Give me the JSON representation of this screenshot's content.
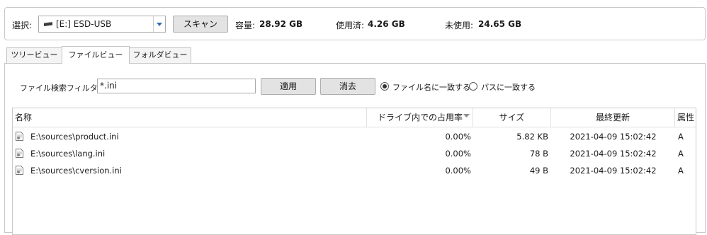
{
  "toolbar": {
    "select_label": "選択:",
    "drive_value": "[E:] ESD-USB",
    "scan_button": "スキャン",
    "capacity_label": "容量:",
    "capacity_value": "28.92 GB",
    "used_label": "使用済:",
    "used_value": "4.26 GB",
    "free_label": "未使用:",
    "free_value": "24.65 GB"
  },
  "tabs": [
    {
      "label": "ツリービュー",
      "active": false
    },
    {
      "label": "ファイルビュー",
      "active": true
    },
    {
      "label": "フォルダビュー",
      "active": false
    }
  ],
  "filter": {
    "label": "ファイル検索フィルター:",
    "value": "*.ini",
    "apply_button": "適用",
    "clear_button": "消去",
    "options": [
      {
        "label": "ファイル名に一致する",
        "selected": true
      },
      {
        "label": "パスに一致する",
        "selected": false
      }
    ]
  },
  "table": {
    "columns": [
      "名称",
      "ドライブ内での占用率",
      "サイズ",
      "最終更新",
      "属性"
    ],
    "sort_column": "ドライブ内での占用率",
    "rows": [
      {
        "name": "E:\\sources\\product.ini",
        "usage": "0.00%",
        "size": "5.82 KB",
        "modified": "2021-04-09 15:02:42",
        "attr": "A"
      },
      {
        "name": "E:\\sources\\lang.ini",
        "usage": "0.00%",
        "size": "78 B",
        "modified": "2021-04-09 15:02:42",
        "attr": "A"
      },
      {
        "name": "E:\\sources\\cversion.ini",
        "usage": "0.00%",
        "size": "49 B",
        "modified": "2021-04-09 15:02:42",
        "attr": "A"
      }
    ]
  },
  "icons": {
    "drive": "usb-drive-icon",
    "file": "ini-file-icon",
    "dropdown": "chevron-down-icon",
    "sort": "sort-desc-icon"
  }
}
